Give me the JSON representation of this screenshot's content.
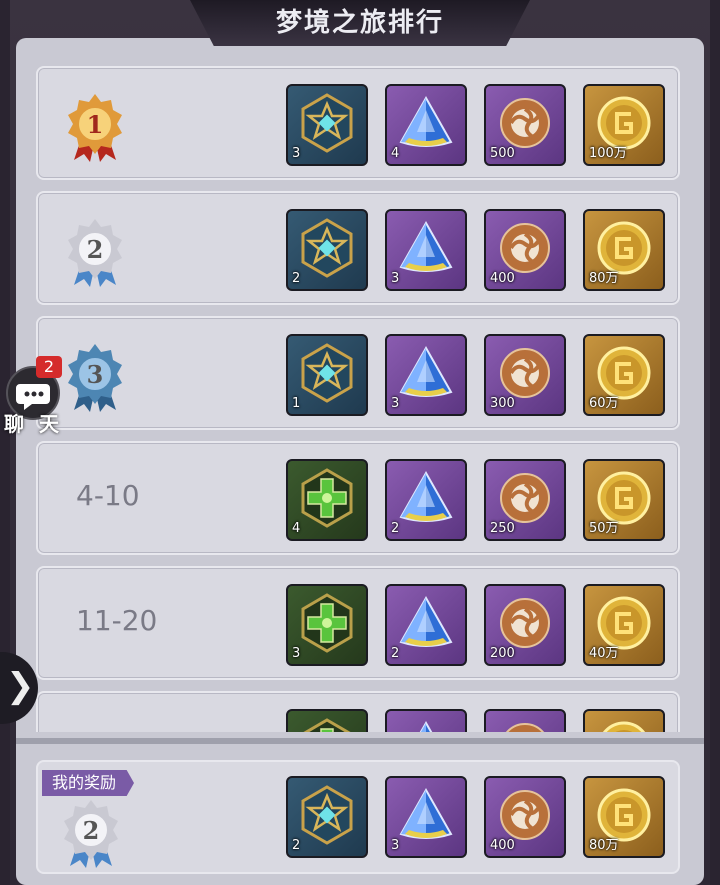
{
  "title": "梦境之旅排行",
  "chat": {
    "label": "聊 天",
    "badge": "2",
    "icon": "chat-bubble-icon"
  },
  "rows": [
    {
      "rank": 1,
      "rank_text": "1",
      "medal": "gold-medal-icon",
      "range": "",
      "rewards": [
        {
          "icon": "blue-star-crest-icon",
          "frame": "blue",
          "qty": "3"
        },
        {
          "icon": "blue-crystal-icon",
          "frame": "purple",
          "qty": "4"
        },
        {
          "icon": "orb-icon",
          "frame": "purple",
          "qty": "500"
        },
        {
          "icon": "gold-coin-icon",
          "frame": "gold",
          "qty": "100万"
        }
      ]
    },
    {
      "rank": 2,
      "rank_text": "2",
      "medal": "silver-medal-icon",
      "range": "",
      "rewards": [
        {
          "icon": "blue-star-crest-icon",
          "frame": "blue",
          "qty": "2"
        },
        {
          "icon": "blue-crystal-icon",
          "frame": "purple",
          "qty": "3"
        },
        {
          "icon": "orb-icon",
          "frame": "purple",
          "qty": "400"
        },
        {
          "icon": "gold-coin-icon",
          "frame": "gold",
          "qty": "80万"
        }
      ]
    },
    {
      "rank": 3,
      "rank_text": "3",
      "medal": "blue-medal-icon",
      "range": "",
      "rewards": [
        {
          "icon": "blue-star-crest-icon",
          "frame": "blue",
          "qty": "1"
        },
        {
          "icon": "blue-crystal-icon",
          "frame": "purple",
          "qty": "3"
        },
        {
          "icon": "orb-icon",
          "frame": "purple",
          "qty": "300"
        },
        {
          "icon": "gold-coin-icon",
          "frame": "gold",
          "qty": "60万"
        }
      ]
    },
    {
      "rank": null,
      "rank_text": "",
      "medal": "",
      "range": "4-10",
      "rewards": [
        {
          "icon": "green-cross-crest-icon",
          "frame": "green",
          "qty": "4"
        },
        {
          "icon": "blue-crystal-icon",
          "frame": "purple",
          "qty": "2"
        },
        {
          "icon": "orb-icon",
          "frame": "purple",
          "qty": "250"
        },
        {
          "icon": "gold-coin-icon",
          "frame": "gold",
          "qty": "50万"
        }
      ]
    },
    {
      "rank": null,
      "rank_text": "",
      "medal": "",
      "range": "11-20",
      "rewards": [
        {
          "icon": "green-cross-crest-icon",
          "frame": "green",
          "qty": "3"
        },
        {
          "icon": "blue-crystal-icon",
          "frame": "purple",
          "qty": "2"
        },
        {
          "icon": "orb-icon",
          "frame": "purple",
          "qty": "200"
        },
        {
          "icon": "gold-coin-icon",
          "frame": "gold",
          "qty": "40万"
        }
      ]
    },
    {
      "rank": null,
      "rank_text": "",
      "medal": "",
      "range": "",
      "rewards": [
        {
          "icon": "green-cross-crest-icon",
          "frame": "green",
          "qty": ""
        },
        {
          "icon": "blue-crystal-icon",
          "frame": "purple",
          "qty": ""
        },
        {
          "icon": "orb-icon",
          "frame": "purple",
          "qty": ""
        },
        {
          "icon": "gold-coin-icon",
          "frame": "gold",
          "qty": ""
        }
      ]
    }
  ],
  "my_reward": {
    "label": "我的奖励",
    "rank": 2,
    "rank_text": "2",
    "medal": "silver-medal-icon",
    "rewards": [
      {
        "icon": "blue-star-crest-icon",
        "frame": "blue",
        "qty": "2"
      },
      {
        "icon": "blue-crystal-icon",
        "frame": "purple",
        "qty": "3"
      },
      {
        "icon": "orb-icon",
        "frame": "purple",
        "qty": "400"
      },
      {
        "icon": "gold-coin-icon",
        "frame": "gold",
        "qty": "80万"
      }
    ]
  },
  "colors": {
    "gold_medal": "#d9822b",
    "silver_medal": "#b7b7c2",
    "blue_medal": "#4d86b3",
    "accent": "#7a5ba6"
  }
}
